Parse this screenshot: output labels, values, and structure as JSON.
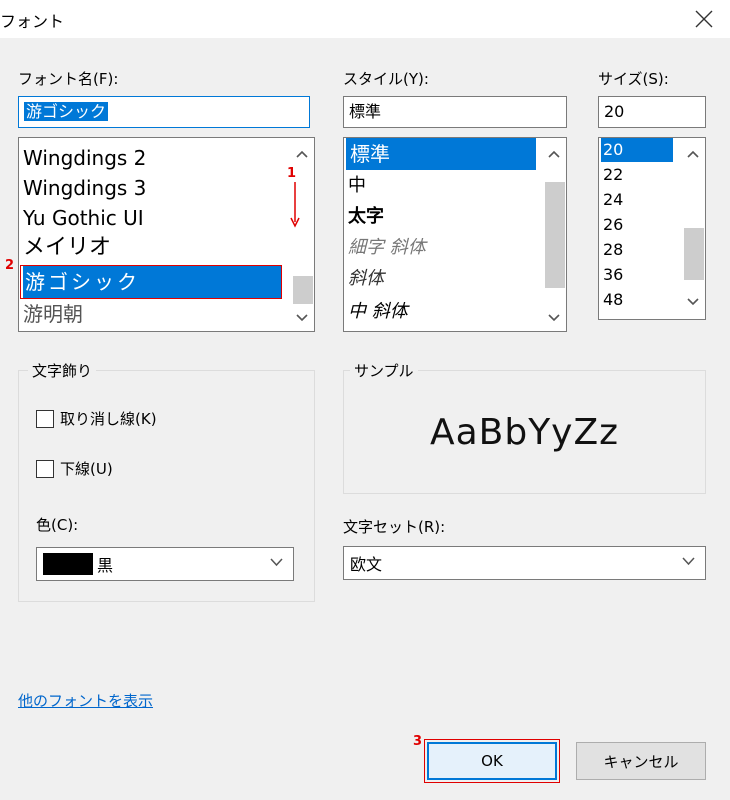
{
  "dialog": {
    "title": "フォント"
  },
  "font_name": {
    "label": "フォント名(F):",
    "value": "游ゴシック",
    "items": [
      "Wingdings 2",
      "Wingdings 3",
      "Yu Gothic UI",
      "メイリオ",
      "游ゴシック",
      "游明朝"
    ],
    "selected_index": 4
  },
  "style": {
    "label": "スタイル(Y):",
    "value": "標準",
    "items": [
      "標準",
      "中",
      "太字",
      "細字 斜体",
      "斜体",
      "中 斜体"
    ],
    "selected_index": 0
  },
  "size": {
    "label": "サイズ(S):",
    "value": "20",
    "items": [
      "20",
      "22",
      "24",
      "26",
      "28",
      "36",
      "48"
    ],
    "selected_index": 0
  },
  "effects": {
    "title": "文字飾り",
    "strikeout_label": "取り消し線(K)",
    "strikeout_checked": false,
    "underline_label": "下線(U)",
    "underline_checked": false,
    "color_label": "色(C):",
    "color_value": "黒",
    "color_swatch": "#000000"
  },
  "sample": {
    "title": "サンプル",
    "text": "AaBbYyZz"
  },
  "charset": {
    "label": "文字セット(R):",
    "value": "欧文"
  },
  "more_fonts_link": "他のフォントを表示",
  "buttons": {
    "ok": "OK",
    "cancel": "キャンセル"
  },
  "annotations": {
    "step1": "1",
    "step2": "2",
    "step3": "3"
  },
  "colors": {
    "accent": "#0078d7",
    "annotation": "#e00000"
  }
}
